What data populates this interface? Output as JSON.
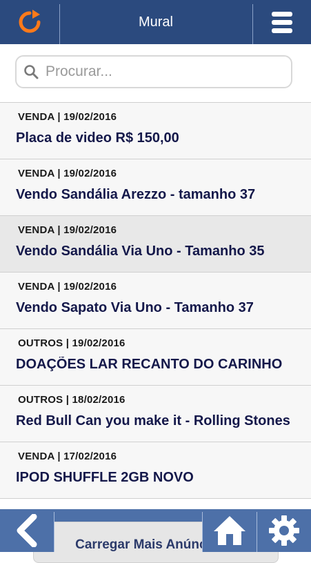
{
  "header": {
    "title": "Mural",
    "refresh_icon": "refresh-icon",
    "menu_icon": "hamburger-menu-icon",
    "accent_color": "#ff7a1a",
    "background_color": "#2b4a7e"
  },
  "search": {
    "placeholder": "Procurar...",
    "value": "",
    "icon": "search-icon"
  },
  "listings": [
    {
      "meta": "VENDA | 19/02/2016",
      "title": "Placa de video R$ 150,00"
    },
    {
      "meta": "VENDA | 19/02/2016",
      "title": "Vendo Sandália Arezzo - tamanho 37"
    },
    {
      "meta": "VENDA | 19/02/2016",
      "title": "Vendo Sandália Via Uno - Tamanho 35"
    },
    {
      "meta": "VENDA | 19/02/2016",
      "title": "Vendo Sapato Via Uno - Tamanho 37"
    },
    {
      "meta": "OUTROS | 19/02/2016",
      "title": "DOAÇÕES LAR RECANTO DO CARINHO"
    },
    {
      "meta": "OUTROS | 18/02/2016",
      "title": "Red Bull Can you make it - Rolling Stones"
    },
    {
      "meta": "VENDA | 17/02/2016",
      "title": "IPOD SHUFFLE 2GB NOVO"
    }
  ],
  "footer": {
    "load_more_label": "Carregar Mais Anúncios...",
    "back_icon": "back-arrow-icon",
    "home_icon": "home-icon",
    "settings_icon": "settings-gear-icon",
    "background_color": "#4d70a8"
  }
}
